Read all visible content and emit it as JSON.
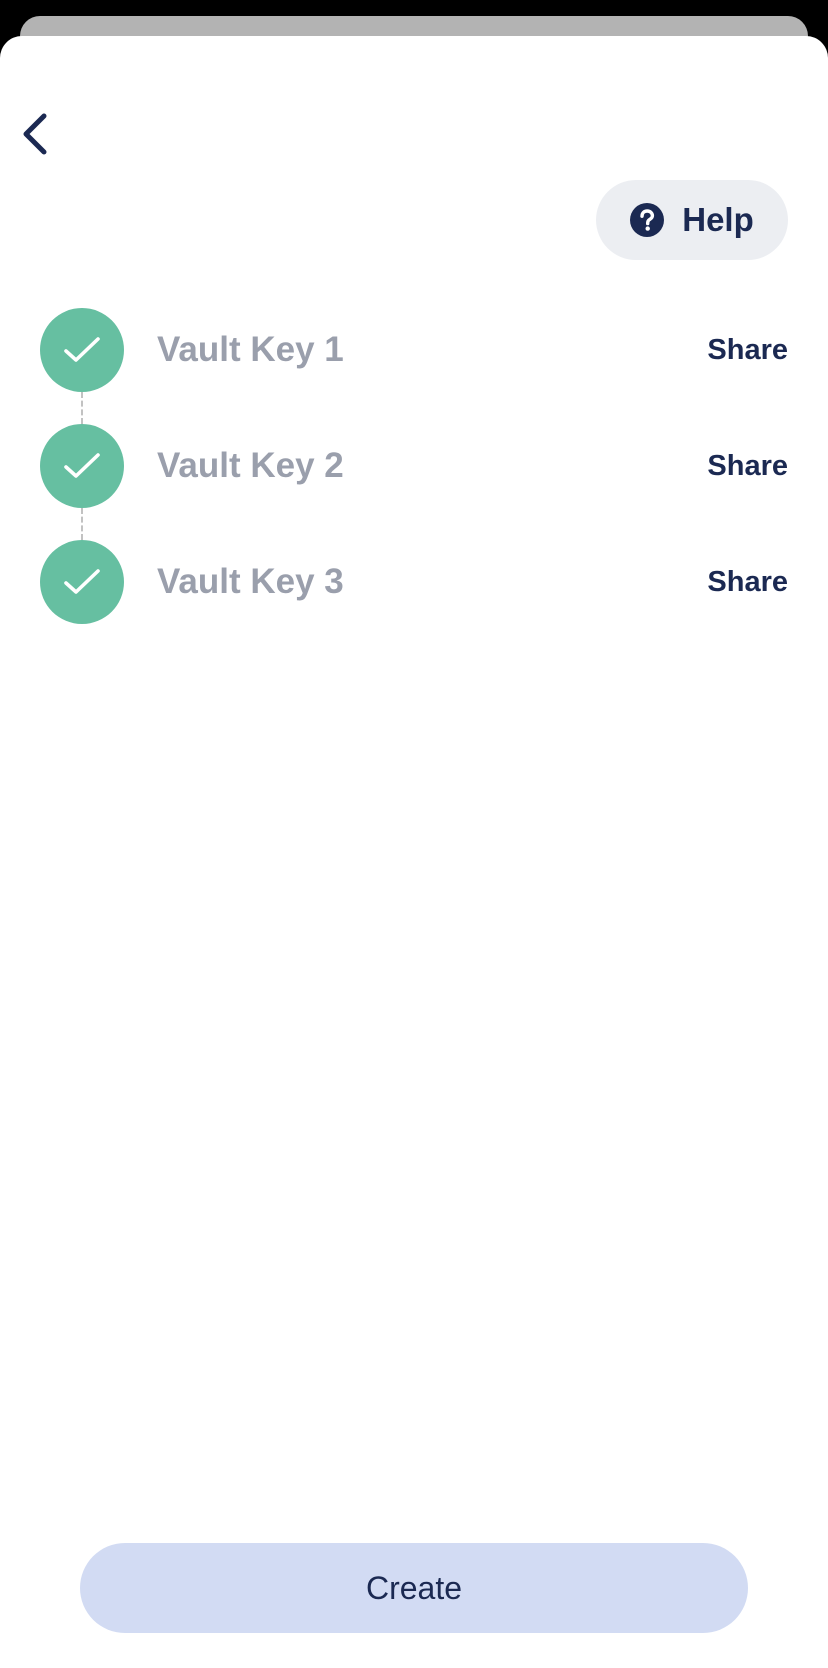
{
  "header": {
    "back_icon": "chevron-left-icon",
    "help": {
      "icon": "question-circle-icon",
      "label": "Help"
    }
  },
  "keys": [
    {
      "label": "Vault Key 1",
      "status": "complete",
      "status_icon": "check-icon",
      "action": "Share"
    },
    {
      "label": "Vault Key 2",
      "status": "complete",
      "status_icon": "check-icon",
      "action": "Share"
    },
    {
      "label": "Vault Key 3",
      "status": "complete",
      "status_icon": "check-icon",
      "action": "Share"
    }
  ],
  "footer": {
    "create_label": "Create"
  },
  "colors": {
    "accent_dark": "#1b2952",
    "success_green": "#66bfa1",
    "muted_text": "#9a9fac",
    "help_bg": "#eceef2",
    "create_bg": "#d2dbf3"
  }
}
